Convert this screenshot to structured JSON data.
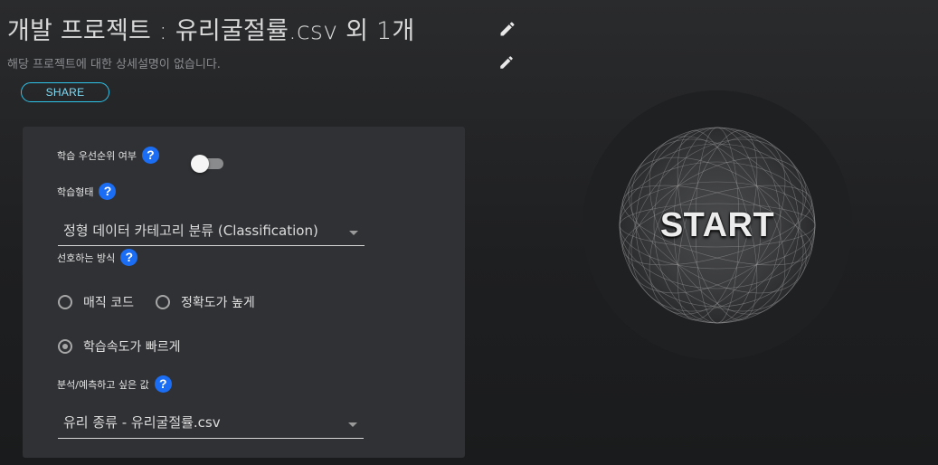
{
  "header": {
    "title": "개발 프로젝트 : 유리굴절률.csv 외 1개",
    "subtitle": "해당 프로젝트에 대한 상세설명이 없습니다.",
    "title_edit_icon": "pencil-icon",
    "subtitle_edit_icon": "pencil-icon",
    "share_label": "SHARE"
  },
  "form": {
    "priority_label": "학습 우선순위 여부",
    "priority_enabled": false,
    "type_label": "학습형태",
    "type_value": "정형 데이터 카테고리 분류 (Classification)",
    "method_label": "선호하는 방식",
    "method_options": [
      "매직 코드",
      "정확도가 높게",
      "학습속도가 빠르게"
    ],
    "method_selected": "학습속도가 빠르게",
    "target_label": "분석/예측하고 싶은 값",
    "target_value": "유리 종류 - 유리굴절률.csv",
    "help_glyph": "?"
  },
  "start": {
    "label": "START"
  },
  "colors": {
    "accent": "#2ec4ea",
    "help": "#1b6ef3",
    "panel": "#2f3134"
  }
}
